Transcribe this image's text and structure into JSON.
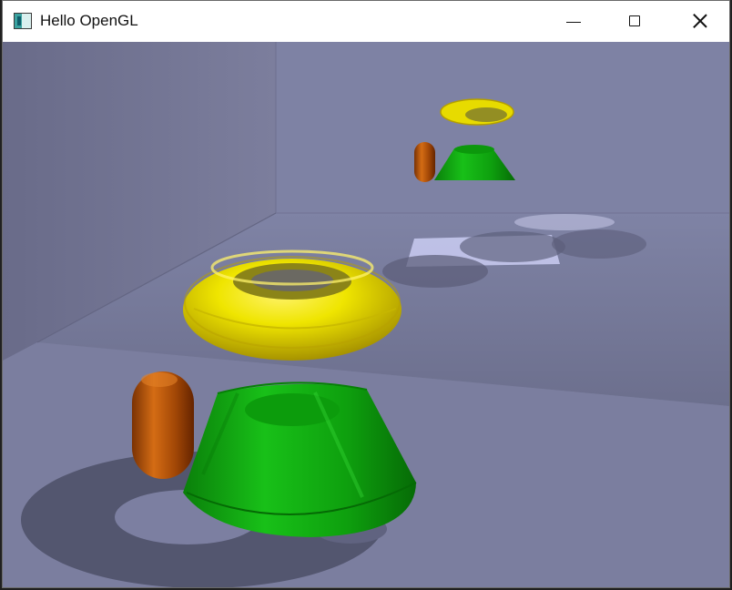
{
  "window": {
    "title": "Hello OpenGL",
    "app_icon": "opengl-app-icon",
    "controls": {
      "minimize_icon": "minimize-icon",
      "maximize_icon": "maximize-icon",
      "close_icon": "close-icon"
    }
  },
  "scene": {
    "objects": [
      "yellow-torus",
      "green-truncated-cone",
      "orange-capsule"
    ],
    "colors": {
      "torus": "#f2e400",
      "cone": "#10b010",
      "capsule": "#c85a08",
      "wall": "#8a8db0",
      "floor": "#7c7fa0",
      "shadow": "#4e5067"
    }
  }
}
